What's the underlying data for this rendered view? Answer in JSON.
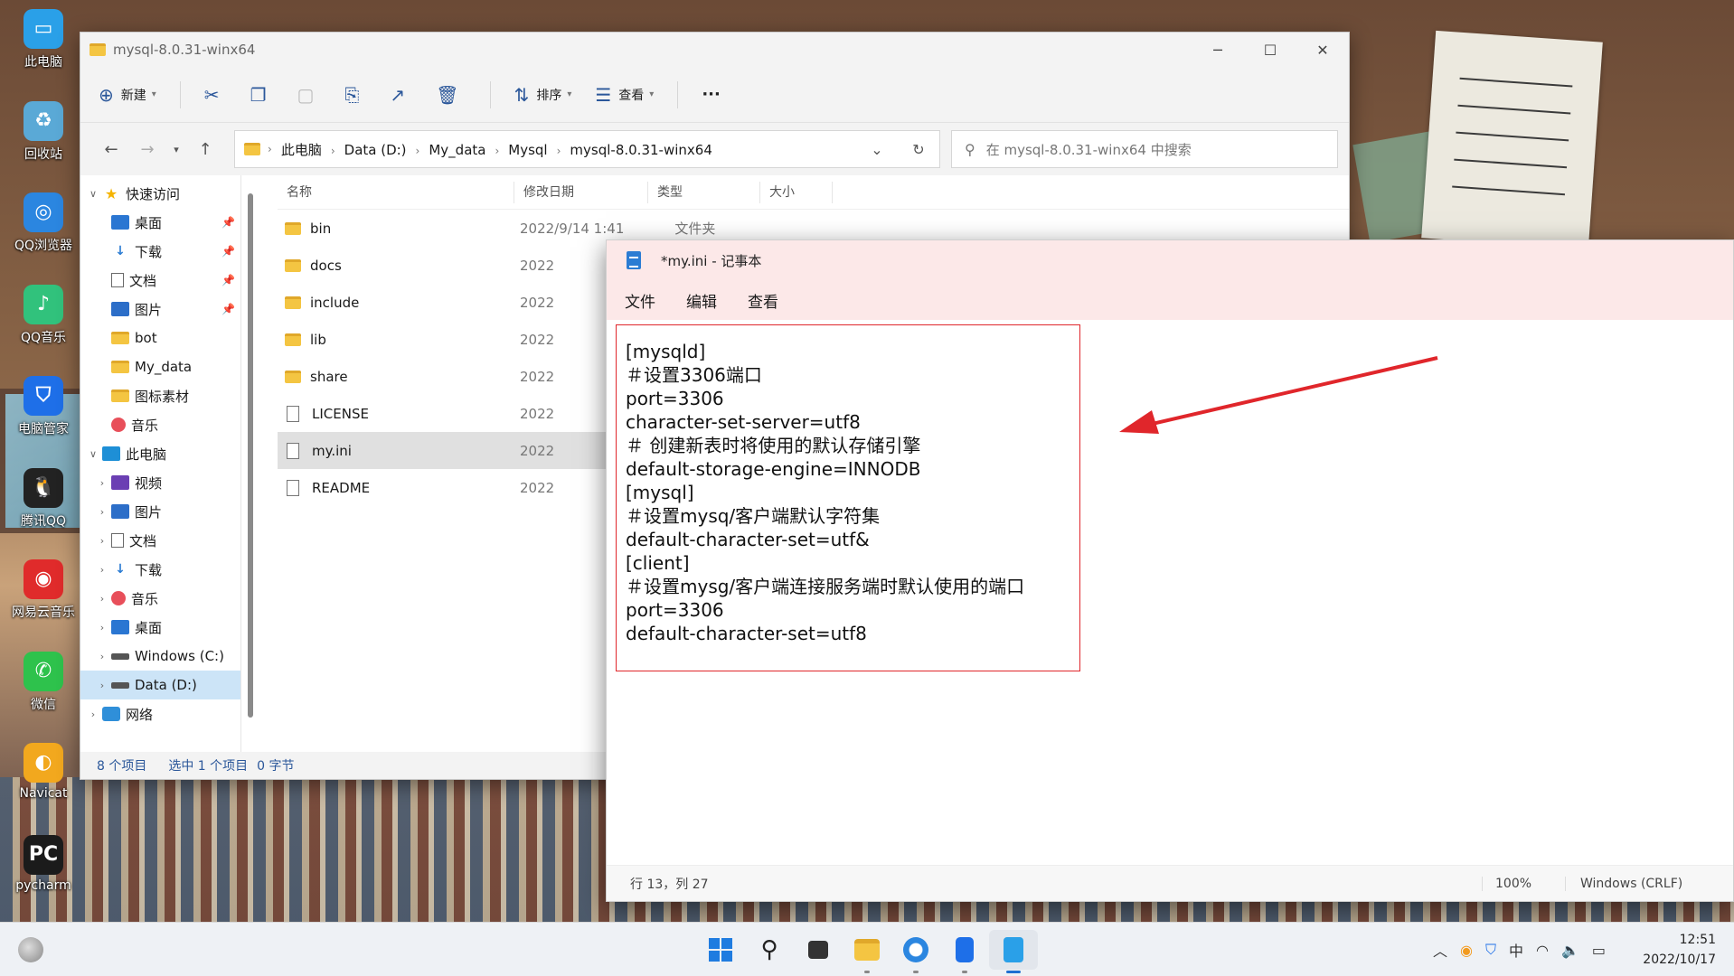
{
  "desktop": {
    "icons": [
      {
        "label": "此电脑",
        "icon": "computer-icon",
        "color": "#2aa0e8"
      },
      {
        "label": "回收站",
        "icon": "recycle-bin-icon",
        "color": "#5aa9d6"
      },
      {
        "label": "QQ浏览器",
        "icon": "qq-browser-icon",
        "color": "#2b86e0"
      },
      {
        "label": "QQ音乐",
        "icon": "qq-music-icon",
        "color": "#31c27c"
      },
      {
        "label": "电脑管家",
        "icon": "pc-manager-icon",
        "color": "#1e6fe8"
      },
      {
        "label": "腾讯QQ",
        "icon": "qq-penguin-icon",
        "color": "#222222"
      },
      {
        "label": "网易云音乐",
        "icon": "netease-music-icon",
        "color": "#e02b2b"
      },
      {
        "label": "微信",
        "icon": "wechat-icon",
        "color": "#2ec24c"
      },
      {
        "label": "Navicat",
        "icon": "navicat-icon",
        "color": "#f2a81e"
      },
      {
        "label": "pycharm",
        "icon": "pycharm-icon",
        "color": "#1b1b1b"
      }
    ]
  },
  "explorer": {
    "title": "mysql-8.0.31-winx64",
    "toolbar": {
      "new_label": "新建",
      "sort_label": "排序",
      "view_label": "查看",
      "more_label": "···"
    },
    "breadcrumbs": [
      "此电脑",
      "Data (D:)",
      "My_data",
      "Mysql",
      "mysql-8.0.31-winx64"
    ],
    "search_placeholder": "在 mysql-8.0.31-winx64 中搜索",
    "sidebar": {
      "quick_access": "快速访问",
      "quick_items": [
        "桌面",
        "下载",
        "文档",
        "图片",
        "bot",
        "My_data",
        "图标素材",
        "音乐"
      ],
      "this_pc": "此电脑",
      "pc_items": [
        "视频",
        "图片",
        "文档",
        "下载",
        "音乐",
        "桌面",
        "Windows (C:)",
        "Data (D:)"
      ],
      "network": "网络"
    },
    "columns": {
      "name": "名称",
      "modified": "修改日期",
      "type": "类型",
      "size": "大小"
    },
    "files": [
      {
        "name": "bin",
        "kind": "folder",
        "date": "2022/9/14 1:41",
        "type": "文件夹"
      },
      {
        "name": "docs",
        "kind": "folder",
        "date": "2022"
      },
      {
        "name": "include",
        "kind": "folder",
        "date": "2022"
      },
      {
        "name": "lib",
        "kind": "folder",
        "date": "2022"
      },
      {
        "name": "share",
        "kind": "folder",
        "date": "2022"
      },
      {
        "name": "LICENSE",
        "kind": "file",
        "date": "2022"
      },
      {
        "name": "my.ini",
        "kind": "ini",
        "date": "2022"
      },
      {
        "name": "README",
        "kind": "file",
        "date": "2022"
      }
    ],
    "status": {
      "count": "8 个项目",
      "selected": "选中 1 个项目",
      "size": "0 字节"
    }
  },
  "notepad": {
    "title": "*my.ini - 记事本",
    "menu": [
      "文件",
      "编辑",
      "查看"
    ],
    "lines": [
      "[mysqld]",
      "＃设置3306端口",
      "port=3306",
      "character-set-server=utf8",
      "＃ 创建新表时将使用的默认存储引擎",
      "default-storage-engine=INNODB",
      "[mysql]",
      "＃设置mysq/客户端默认字符集",
      "default-character-set=utf&",
      "[client]",
      "＃设置mysg/客户端连接服务端时默认使用的端口",
      "port=3306",
      "default-character-set=utf8"
    ],
    "status": {
      "position": "行 13，列 27",
      "zoom": "100%",
      "encoding": "Windows (CRLF)"
    }
  },
  "taskbar": {
    "apps": [
      "windows-start-icon",
      "search-icon",
      "task-view-icon",
      "file-explorer-icon",
      "qq-browser-icon",
      "phone-icon",
      "notepad-icon"
    ],
    "tray_ime": "中",
    "time": "12:51",
    "date": "2022/10/17"
  },
  "colors": {
    "annotation_red": "#e0262b",
    "accent": "#1f6fd1"
  }
}
